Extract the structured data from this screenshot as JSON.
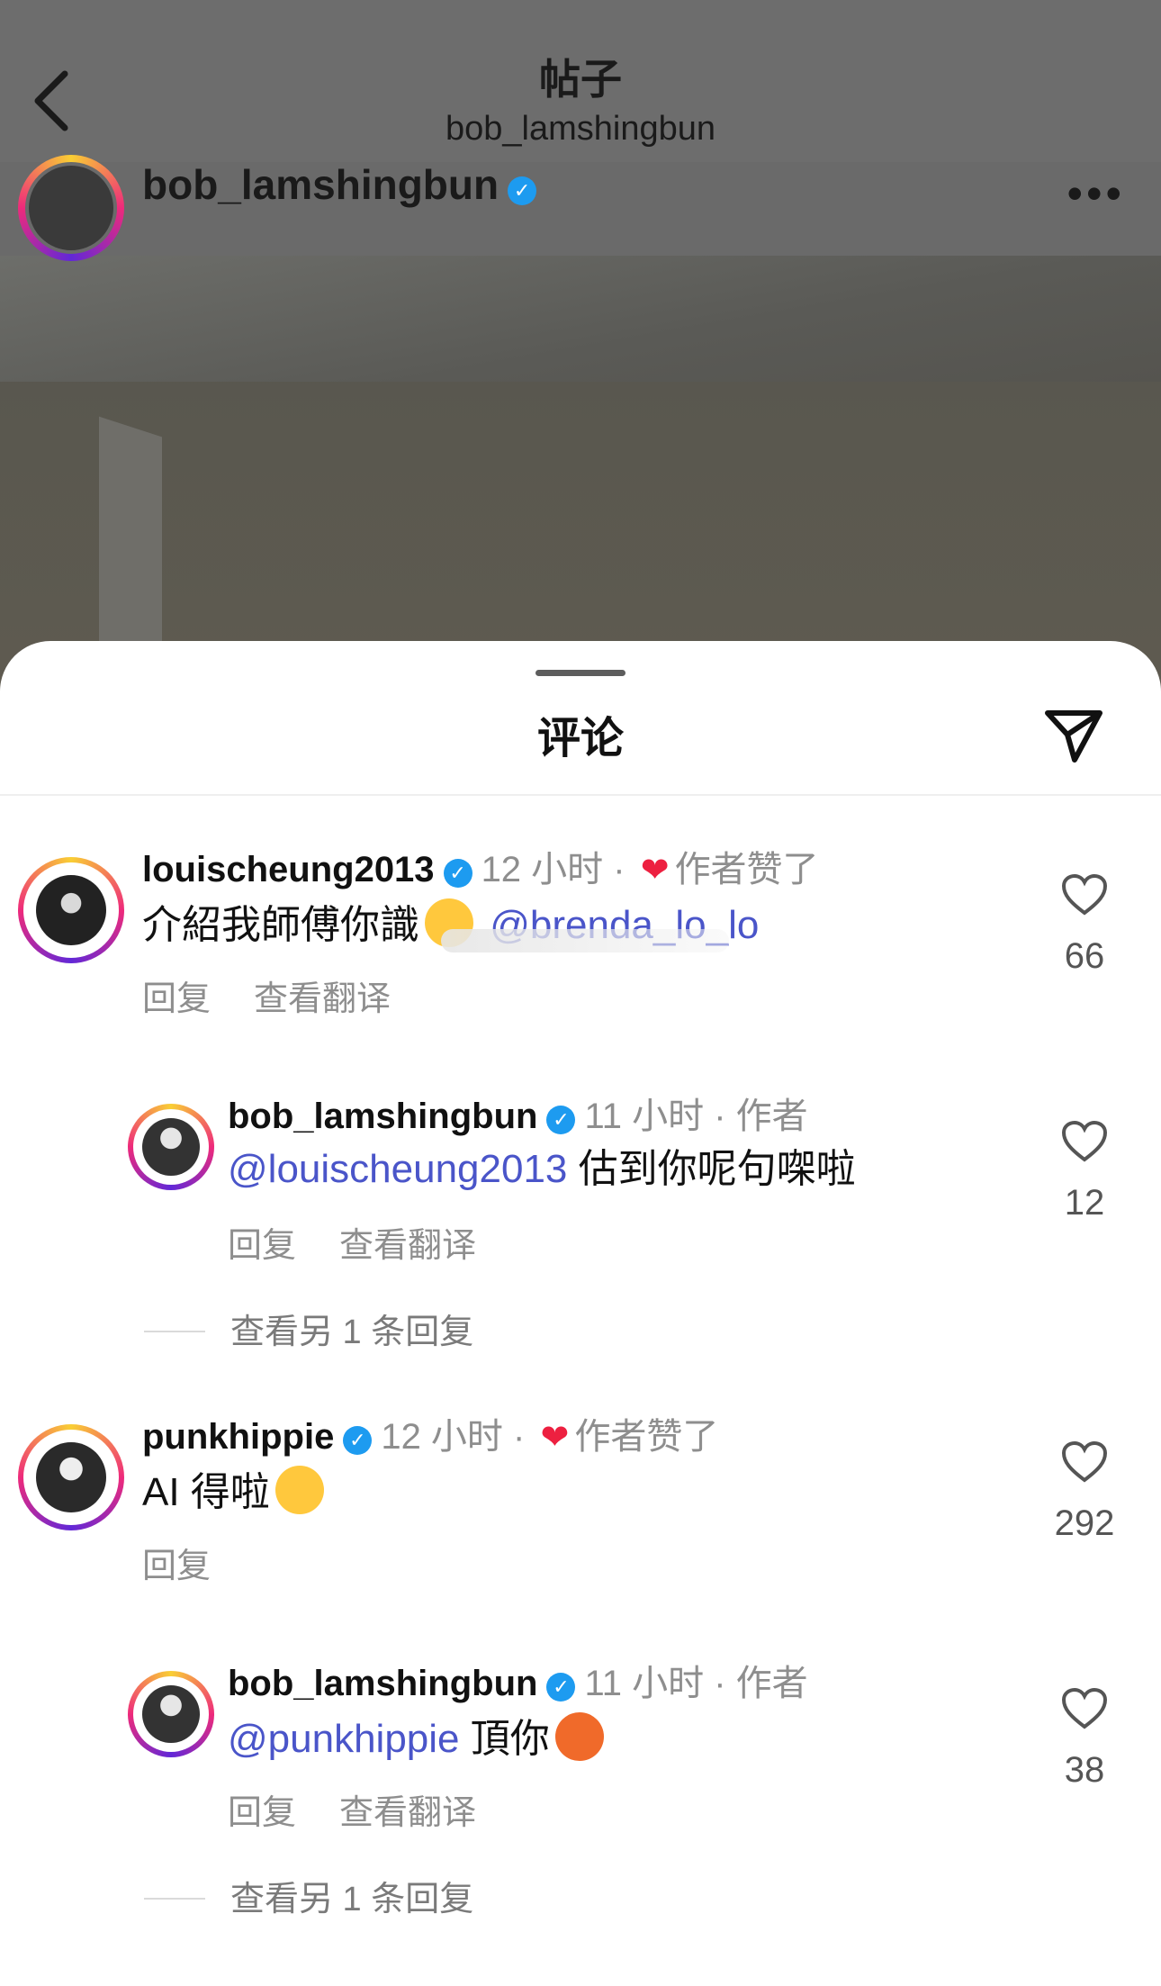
{
  "nav": {
    "title": "帖子",
    "subtitle": "bob_lamshingbun"
  },
  "post": {
    "username": "bob_lamshingbun",
    "more": "•••"
  },
  "sheet": {
    "title": "评论"
  },
  "comments": [
    {
      "username": "louischeung2013",
      "time": "12 小时",
      "liked_by_author": "作者赞了",
      "text": "介紹我師傅你識",
      "mention": "@brenda_lo_lo",
      "reply": "回复",
      "translate": "查看翻译",
      "likes": "66"
    },
    {
      "username": "bob_lamshingbun",
      "time": "11 小时",
      "role": "作者",
      "mention": "@louischeung2013",
      "text": "估到你呢句㗎啦",
      "reply": "回复",
      "translate": "查看翻译",
      "likes": "12",
      "more_replies": "查看另 1 条回复"
    },
    {
      "username": "punkhippie",
      "time": "12 小时",
      "liked_by_author": "作者赞了",
      "text": "AI 得啦",
      "reply": "回复",
      "likes": "292"
    },
    {
      "username": "bob_lamshingbun",
      "time": "11 小时",
      "role": "作者",
      "mention": "@punkhippie",
      "text": "頂你",
      "reply": "回复",
      "translate": "查看翻译",
      "likes": "38",
      "more_replies": "查看另 1 条回复"
    }
  ],
  "colors": {
    "verified": "#1d9bf0",
    "mention": "#4a55c9",
    "liked_heart": "#ed2040"
  }
}
